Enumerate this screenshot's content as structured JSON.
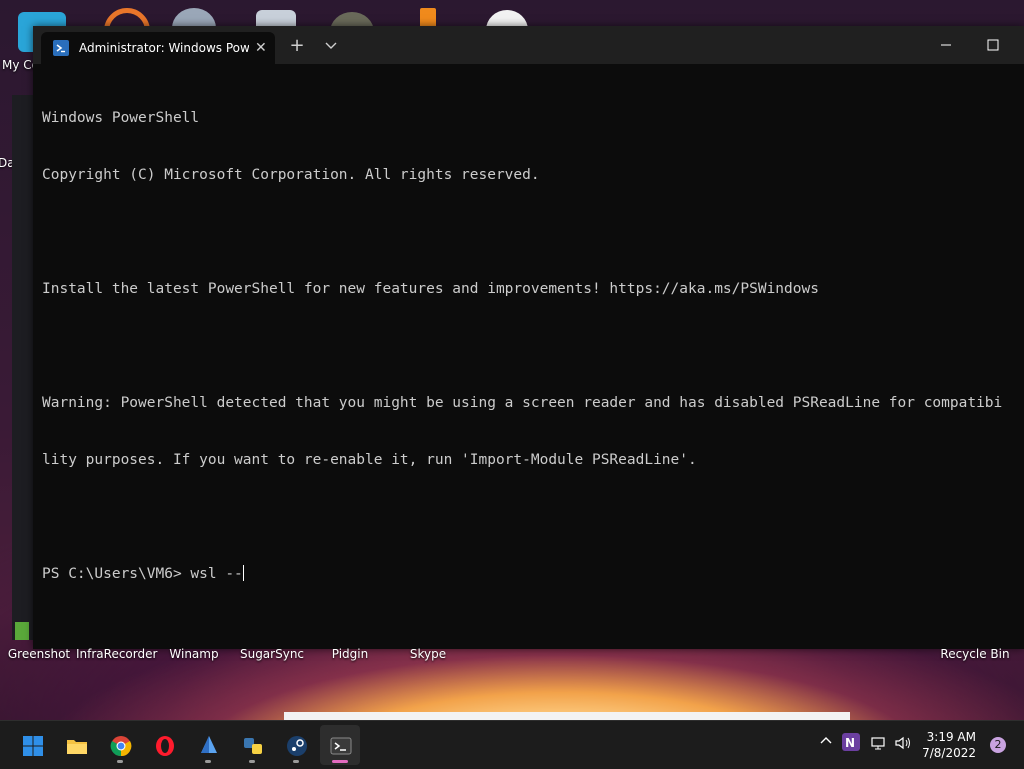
{
  "desktop": {
    "top_labels": [
      "My Co",
      "Da"
    ],
    "bottom_labels": [
      "Greenshot",
      "InfraRecorder",
      "Winamp",
      "SugarSync",
      "Pidgin",
      "Skype",
      "Recycle Bin"
    ]
  },
  "terminal": {
    "tab_title": "Administrator: Windows PowerS",
    "tab_close": "✕",
    "new_tab": "+",
    "dropdown": "⌄",
    "lines": [
      "Windows PowerShell",
      "Copyright (C) Microsoft Corporation. All rights reserved.",
      "",
      "Install the latest PowerShell for new features and improvements! https://aka.ms/PSWindows",
      "",
      "Warning: PowerShell detected that you might be using a screen reader and has disabled PSReadLine for compatibi",
      "lity purposes. If you want to re-enable it, run 'Import-Module PSReadLine'.",
      "",
      "PS C:\\Users\\VM6> wsl --"
    ]
  },
  "taskbar": {
    "apps": [
      "start",
      "file-explorer",
      "chrome",
      "opera",
      "unknown-app",
      "python-app",
      "steam",
      "terminal"
    ],
    "clock_time": "3:19 AM",
    "clock_date": "7/8/2022",
    "notification_count": "2",
    "colors": {
      "accent": "#e36bc0",
      "start_blue": "#2f8fe8"
    }
  }
}
